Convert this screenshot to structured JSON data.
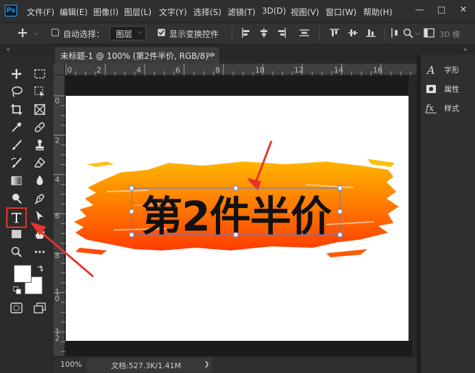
{
  "app": {
    "logo": "Ps"
  },
  "menu": [
    "文件(F)",
    "编辑(E)",
    "图像(I)",
    "图层(L)",
    "文字(Y)",
    "选择(S)",
    "滤镜(T)",
    "3D(D)",
    "视图(V)",
    "窗口(W)",
    "帮助(H)"
  ],
  "window_controls": {
    "minimize": "—",
    "maximize": "□",
    "close": "✕"
  },
  "options": {
    "auto_select_label": "自动选择：",
    "auto_select_checked": false,
    "target_value": "图层",
    "show_transform_label": "显示变换控件",
    "show_transform_checked": true,
    "mode_3d": "3D 模"
  },
  "document": {
    "tab_title": "未标题-1 @ 100% (第2件半价, RGB/8) *",
    "close": "×"
  },
  "ruler": {
    "top_labels": [
      "0",
      "2",
      "4",
      "6",
      "8",
      "10",
      "12",
      "14",
      "16"
    ],
    "left_labels": [
      "0",
      "2",
      "4",
      "6",
      "8",
      "1 0",
      "1 2"
    ]
  },
  "canvas": {
    "text": "第2件半价",
    "text_color": "#111111",
    "brush_color_top": "#ffb400",
    "brush_color_bottom": "#ff3d00",
    "arrow_color": "#e8332b"
  },
  "status": {
    "zoom": "100%",
    "doc_info": "文档:527.3K/1.41M",
    "arrow": "❯"
  },
  "panels": [
    {
      "icon": "character-icon",
      "label": "字形"
    },
    {
      "icon": "properties-icon",
      "label": "属性"
    },
    {
      "icon": "styles-icon",
      "label": "样式"
    }
  ],
  "colors": {
    "accent": "#31a8ff",
    "highlight": "#e8332b",
    "foreground_swatch": "#ffffff",
    "background_swatch": "#ffffff"
  }
}
